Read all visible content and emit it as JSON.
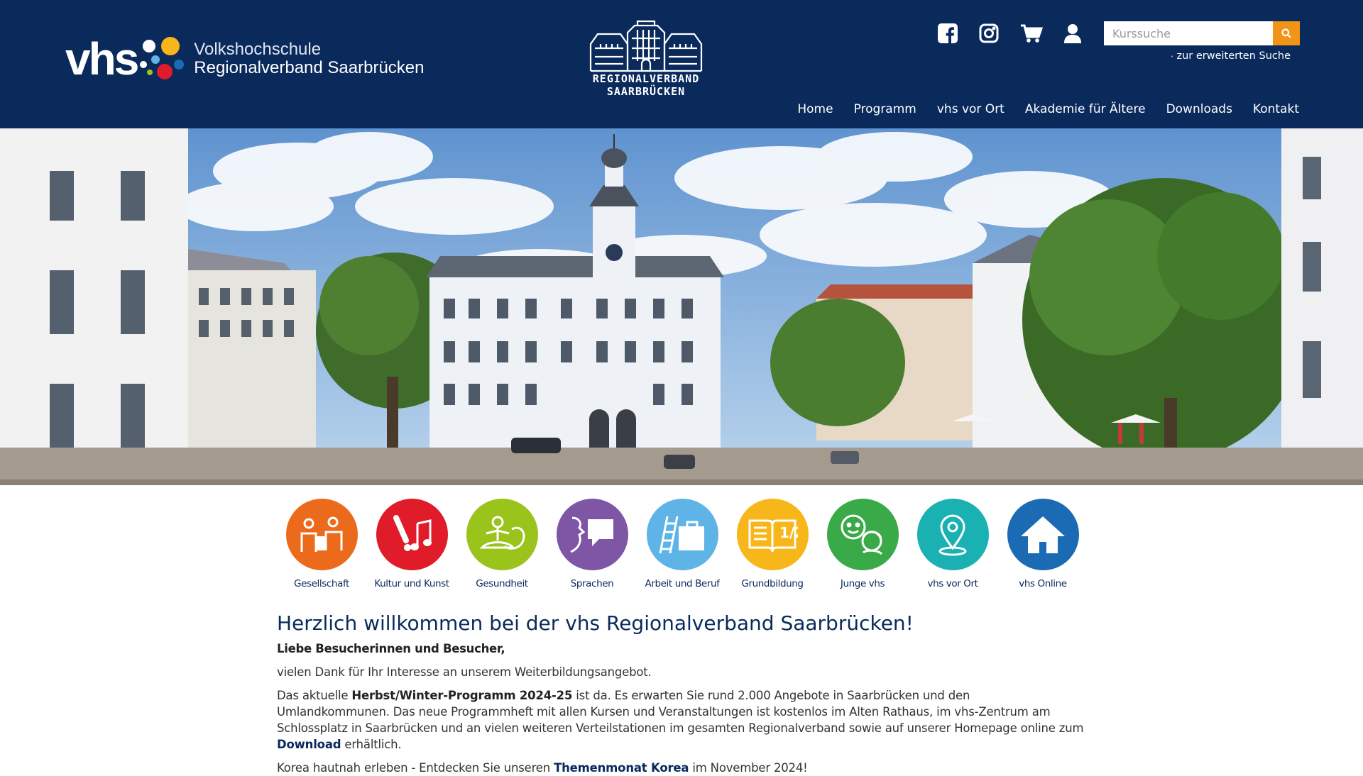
{
  "header": {
    "logo": {
      "vhs": "vhs",
      "line1": "Volkshochschule",
      "line2": "Regionalverband Saarbrücken"
    },
    "center_logo": {
      "line1": "REGIONALVERBAND",
      "line2": "SAARBRÜCKEN"
    },
    "social": [
      {
        "icon": "facebook-icon"
      },
      {
        "icon": "instagram-icon"
      },
      {
        "icon": "shopping-cart-icon"
      },
      {
        "icon": "user-icon"
      }
    ],
    "search": {
      "placeholder": "Kurssuche",
      "advanced_label": "zur erweiterten Suche"
    },
    "nav": [
      "Home",
      "Programm",
      "vhs vor Ort",
      "Akademie für Ältere",
      "Downloads",
      "Kontakt"
    ],
    "colors": {
      "header_bg": "#0a2a5c",
      "accent": "#f29418"
    }
  },
  "categories": [
    {
      "label": "Gesellschaft",
      "color": "#ec6a1b",
      "icon": "people-discussion-icon"
    },
    {
      "label": "Kultur und Kunst",
      "color": "#e01c2a",
      "icon": "music-brush-icon"
    },
    {
      "label": "Gesundheit",
      "color": "#9ac31c",
      "icon": "meditation-icon"
    },
    {
      "label": "Sprachen",
      "color": "#7f55a6",
      "icon": "speech-bubble-icon"
    },
    {
      "label": "Arbeit und Beruf",
      "color": "#5eb4e6",
      "icon": "ladder-briefcase-icon"
    },
    {
      "label": "Grundbildung",
      "color": "#f7b619",
      "icon": "book-half-icon"
    },
    {
      "label": "Junge vhs",
      "color": "#3aaa48",
      "icon": "young-faces-icon"
    },
    {
      "label": "vhs vor Ort",
      "color": "#1ab1b2",
      "icon": "location-pin-icon"
    },
    {
      "label": "vhs Online",
      "color": "#1a6bb3",
      "icon": "house-icon"
    }
  ],
  "content": {
    "title": "Herzlich willkommen bei der vhs Regionalverband Saarbrücken!",
    "greeting": "Liebe Besucherinnen und Besucher,",
    "p1": "vielen Dank für Ihr Interesse an unserem Weiterbildungsangebot.",
    "p2_a": "Das aktuelle ",
    "p2_bold": "Herbst/Winter-Programm 2024-25",
    "p2_b": " ist da. Es erwarten Sie rund 2.000 Angebote in Saarbrücken und den Umlandkommunen. Das neue Programmheft mit allen Kursen und Veranstaltungen ist kostenlos im Alten Rathaus, im vhs-Zentrum am Schlossplatz in Saarbrücken und an vielen weiteren Verteilstationen im gesamten Regionalverband sowie auf unserer Homepage online zum ",
    "p2_link": "Download",
    "p2_c": " erhältlich.",
    "p3_a": "Korea hautnah erleben - Entdecken Sie unseren ",
    "p3_link": "Themenmonat Korea",
    "p3_b": " im November 2024!"
  }
}
